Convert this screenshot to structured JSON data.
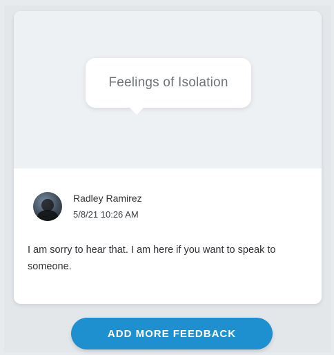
{
  "topic_bubble": {
    "text": "Feelings of Isolation"
  },
  "comment": {
    "author_name": "Radley Ramirez",
    "timestamp": "5/8/21 10:26 AM",
    "message": "I am sorry to hear that. I am here if you want to speak to someone."
  },
  "actions": {
    "add_feedback_label": "ADD MORE FEEDBACK"
  },
  "colors": {
    "page_background": "#e8ebee",
    "card_background": "#ffffff",
    "card_header_background": "#eef1f4",
    "button_background": "#1e8fcf",
    "button_text": "#ffffff"
  },
  "icons": {
    "avatar": "user-avatar-photo"
  }
}
